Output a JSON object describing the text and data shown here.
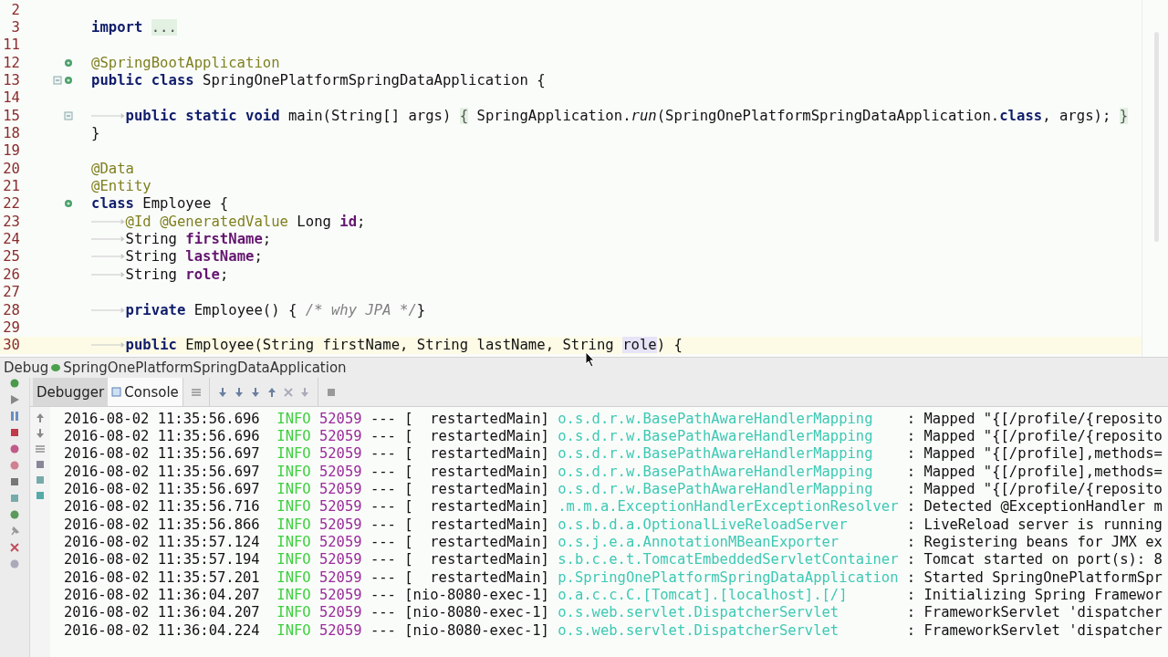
{
  "editor": {
    "lines": [
      {
        "number": "2",
        "current": false,
        "fold": false,
        "bean": false
      },
      {
        "number": "3",
        "current": false,
        "fold": false,
        "bean": false,
        "tokens": [
          {
            "t": "import ",
            "kind": "kw"
          },
          {
            "t": "...",
            "kind": "fold"
          }
        ]
      },
      {
        "number": "11",
        "current": false,
        "fold": false,
        "bean": false
      },
      {
        "number": "12",
        "current": false,
        "fold": false,
        "bean": true,
        "tokens": [
          {
            "t": "@SpringBootApplication",
            "kind": "ann"
          }
        ]
      },
      {
        "number": "13",
        "current": false,
        "fold": true,
        "bean": true,
        "tokens": [
          {
            "t": "public class",
            "kind": "kw"
          },
          {
            "t": " SpringOnePlatformSpringDataApplication {",
            "kind": "plain"
          }
        ]
      },
      {
        "number": "14",
        "current": false,
        "fold": false,
        "bean": false
      },
      {
        "number": "15",
        "current": false,
        "fold": true,
        "bean": false,
        "indented": true,
        "tokens": [
          {
            "t": "public static void",
            "kind": "kw"
          },
          {
            "t": " main(String[] args) ",
            "kind": "plain"
          },
          {
            "t": "{",
            "kind": "fold"
          },
          {
            "t": " SpringApplication.",
            "kind": "plain"
          },
          {
            "t": "run",
            "kind": "italic"
          },
          {
            "t": "(SpringOnePlatformSpringDataApplication.",
            "kind": "plain"
          },
          {
            "t": "class",
            "kind": "kw"
          },
          {
            "t": ", args); ",
            "kind": "plain"
          },
          {
            "t": "}",
            "kind": "fold"
          }
        ]
      },
      {
        "number": "18",
        "current": false,
        "fold": false,
        "bean": false,
        "tokens": [
          {
            "t": "}",
            "kind": "plain"
          }
        ]
      },
      {
        "number": "19",
        "current": false,
        "fold": false,
        "bean": false
      },
      {
        "number": "20",
        "current": false,
        "fold": false,
        "bean": false,
        "tokens": [
          {
            "t": "@Data",
            "kind": "ann"
          }
        ]
      },
      {
        "number": "21",
        "current": false,
        "fold": false,
        "bean": false,
        "tokens": [
          {
            "t": "@Entity",
            "kind": "ann"
          }
        ]
      },
      {
        "number": "22",
        "current": false,
        "fold": false,
        "bean": true,
        "tokens": [
          {
            "t": "class",
            "kind": "kw"
          },
          {
            "t": " Employee {",
            "kind": "plain"
          }
        ]
      },
      {
        "number": "23",
        "current": false,
        "fold": false,
        "bean": false,
        "indented": true,
        "tokens": [
          {
            "t": "@Id @GeneratedValue",
            "kind": "ann"
          },
          {
            "t": " Long ",
            "kind": "plain"
          },
          {
            "t": "id",
            "kind": "field"
          },
          {
            "t": ";",
            "kind": "plain"
          }
        ]
      },
      {
        "number": "24",
        "current": false,
        "fold": false,
        "bean": false,
        "indented": true,
        "tokens": [
          {
            "t": "String ",
            "kind": "plain"
          },
          {
            "t": "firstName",
            "kind": "field"
          },
          {
            "t": ";",
            "kind": "plain"
          }
        ]
      },
      {
        "number": "25",
        "current": false,
        "fold": false,
        "bean": false,
        "indented": true,
        "tokens": [
          {
            "t": "String ",
            "kind": "plain"
          },
          {
            "t": "lastName",
            "kind": "field"
          },
          {
            "t": ";",
            "kind": "plain"
          }
        ]
      },
      {
        "number": "26",
        "current": false,
        "fold": false,
        "bean": false,
        "indented": true,
        "tokens": [
          {
            "t": "String ",
            "kind": "plain"
          },
          {
            "t": "role",
            "kind": "field"
          },
          {
            "t": ";",
            "kind": "plain"
          }
        ]
      },
      {
        "number": "27",
        "current": false,
        "fold": false,
        "bean": false
      },
      {
        "number": "28",
        "current": false,
        "fold": false,
        "bean": false,
        "indented": true,
        "tokens": [
          {
            "t": "private",
            "kind": "kw"
          },
          {
            "t": " Employee() { ",
            "kind": "plain"
          },
          {
            "t": "/* why JPA */",
            "kind": "comment"
          },
          {
            "t": "}",
            "kind": "plain"
          }
        ]
      },
      {
        "number": "29",
        "current": false,
        "fold": false,
        "bean": false
      },
      {
        "number": "30",
        "current": true,
        "fold": false,
        "bean": false,
        "indented": true,
        "tokens": [
          {
            "t": "public",
            "kind": "kw"
          },
          {
            "t": " Employee(String firstName, String lastName, String ",
            "kind": "plain"
          },
          {
            "t": "role",
            "kind": "highlight"
          },
          {
            "t": ") {",
            "kind": "plain"
          }
        ]
      }
    ]
  },
  "debug": {
    "title": "Debug",
    "configuration": "SpringOnePlatformSpringDataApplication",
    "tabs": [
      {
        "label": "Debugger",
        "selected": false
      },
      {
        "label": "Console",
        "selected": true
      }
    ],
    "console": [
      {
        "time": "2016-08-02 11:35:56.696",
        "level": "INFO",
        "pid": "52059",
        "sep": "---",
        "thread": "[  restartedMain]",
        "logger": "o.s.d.r.w.BasePathAwareHandlerMapping",
        "message": ": Mapped \"{[/profile/{reposito"
      },
      {
        "time": "2016-08-02 11:35:56.696",
        "level": "INFO",
        "pid": "52059",
        "sep": "---",
        "thread": "[  restartedMain]",
        "logger": "o.s.d.r.w.BasePathAwareHandlerMapping",
        "message": ": Mapped \"{[/profile/{reposito"
      },
      {
        "time": "2016-08-02 11:35:56.697",
        "level": "INFO",
        "pid": "52059",
        "sep": "---",
        "thread": "[  restartedMain]",
        "logger": "o.s.d.r.w.BasePathAwareHandlerMapping",
        "message": ": Mapped \"{[/profile],methods="
      },
      {
        "time": "2016-08-02 11:35:56.697",
        "level": "INFO",
        "pid": "52059",
        "sep": "---",
        "thread": "[  restartedMain]",
        "logger": "o.s.d.r.w.BasePathAwareHandlerMapping",
        "message": ": Mapped \"{[/profile],methods="
      },
      {
        "time": "2016-08-02 11:35:56.697",
        "level": "INFO",
        "pid": "52059",
        "sep": "---",
        "thread": "[  restartedMain]",
        "logger": "o.s.d.r.w.BasePathAwareHandlerMapping",
        "message": ": Mapped \"{[/profile/{reposito"
      },
      {
        "time": "2016-08-02 11:35:56.716",
        "level": "INFO",
        "pid": "52059",
        "sep": "---",
        "thread": "[  restartedMain]",
        "logger": ".m.m.a.ExceptionHandlerExceptionResolver",
        "message": ": Detected @ExceptionHandler m"
      },
      {
        "time": "2016-08-02 11:35:56.866",
        "level": "INFO",
        "pid": "52059",
        "sep": "---",
        "thread": "[  restartedMain]",
        "logger": "o.s.b.d.a.OptionalLiveReloadServer",
        "message": ": LiveReload server is running"
      },
      {
        "time": "2016-08-02 11:35:57.124",
        "level": "INFO",
        "pid": "52059",
        "sep": "---",
        "thread": "[  restartedMain]",
        "logger": "o.s.j.e.a.AnnotationMBeanExporter",
        "message": ": Registering beans for JMX ex"
      },
      {
        "time": "2016-08-02 11:35:57.194",
        "level": "INFO",
        "pid": "52059",
        "sep": "---",
        "thread": "[  restartedMain]",
        "logger": "s.b.c.e.t.TomcatEmbeddedServletContainer",
        "message": ": Tomcat started on port(s): 8"
      },
      {
        "time": "2016-08-02 11:35:57.201",
        "level": "INFO",
        "pid": "52059",
        "sep": "---",
        "thread": "[  restartedMain]",
        "logger": "p.SpringOnePlatformSpringDataApplication",
        "message": ": Started SpringOnePlatformSpr"
      },
      {
        "time": "2016-08-02 11:36:04.207",
        "level": "INFO",
        "pid": "52059",
        "sep": "---",
        "thread": "[nio-8080-exec-1]",
        "logger": "o.a.c.c.C.[Tomcat].[localhost].[/]",
        "message": ": Initializing Spring Framewor"
      },
      {
        "time": "2016-08-02 11:36:04.207",
        "level": "INFO",
        "pid": "52059",
        "sep": "---",
        "thread": "[nio-8080-exec-1]",
        "logger": "o.s.web.servlet.DispatcherServlet",
        "message": ": FrameworkServlet 'dispatcher"
      },
      {
        "time": "2016-08-02 11:36:04.224",
        "level": "INFO",
        "pid": "52059",
        "sep": "---",
        "thread": "[nio-8080-exec-1]",
        "logger": "o.s.web.servlet.DispatcherServlet",
        "message": ": FrameworkServlet 'dispatcher"
      }
    ]
  }
}
